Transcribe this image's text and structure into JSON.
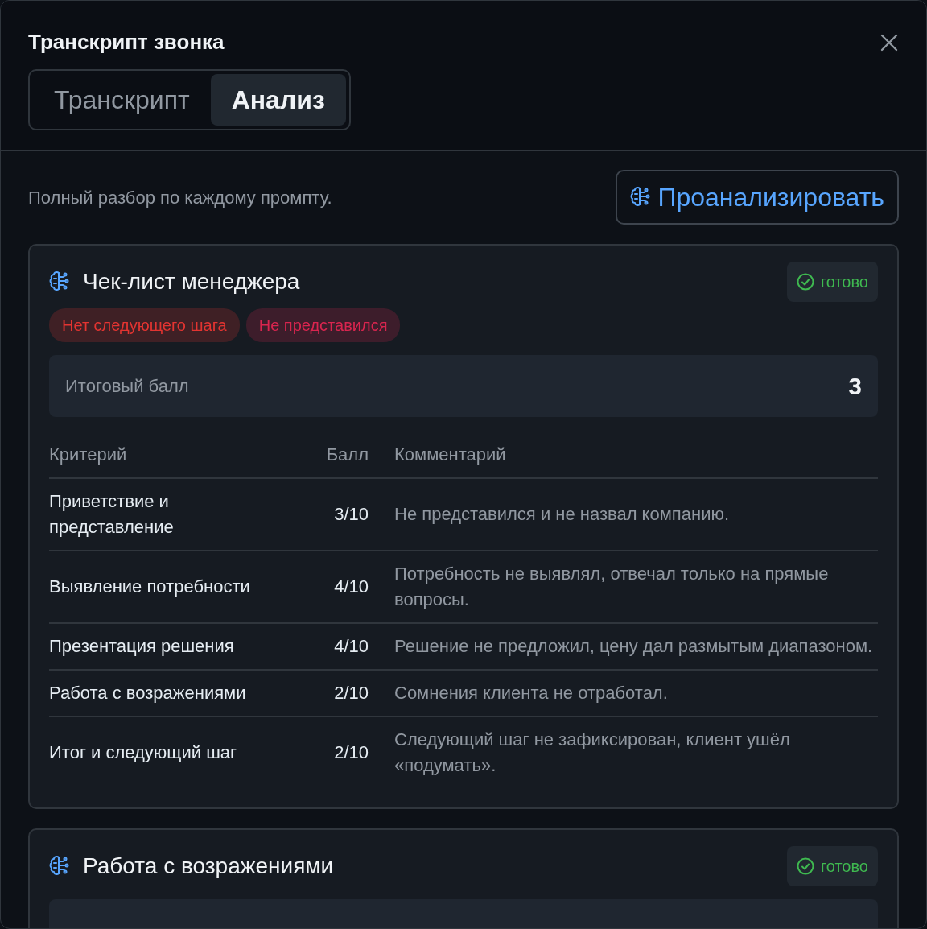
{
  "window": {
    "title": "Транскрипт звонка"
  },
  "tabs": [
    {
      "label": "Транскрипт",
      "selected": false
    },
    {
      "label": "Анализ",
      "selected": true
    }
  ],
  "intro": "Полный разбор по каждому промпту.",
  "analyze_button": "Проанализировать",
  "prompts": [
    {
      "title": "Чек-лист менеджера",
      "status": "готово",
      "tags": [
        {
          "label": "Нет следующего шага",
          "color": "#3f2025"
        },
        {
          "label": "Не представился",
          "color": "#3d1d2b"
        }
      ],
      "score_label": "Итоговый балл",
      "score": "3",
      "table": {
        "columns": [
          "Критерий",
          "Балл",
          "Комментарий"
        ],
        "rows": [
          [
            "Приветствие и представление",
            "3/10",
            "Не представился и не назвал компанию."
          ],
          [
            "Выявление потребности",
            "4/10",
            "Потребность не выявлял, отвечал только на прямые вопросы."
          ],
          [
            "Презентация решения",
            "4/10",
            "Решение не предложил, цену дал размытым диапазоном."
          ],
          [
            "Работа с возражениями",
            "2/10",
            "Сомнения клиента не отработал."
          ],
          [
            "Итог и следующий шаг",
            "2/10",
            "Следующий шаг не зафиксирован, клиент ушёл «подумать»."
          ]
        ]
      }
    },
    {
      "title": "Работа с возражениями",
      "status": "готово"
    }
  ]
}
